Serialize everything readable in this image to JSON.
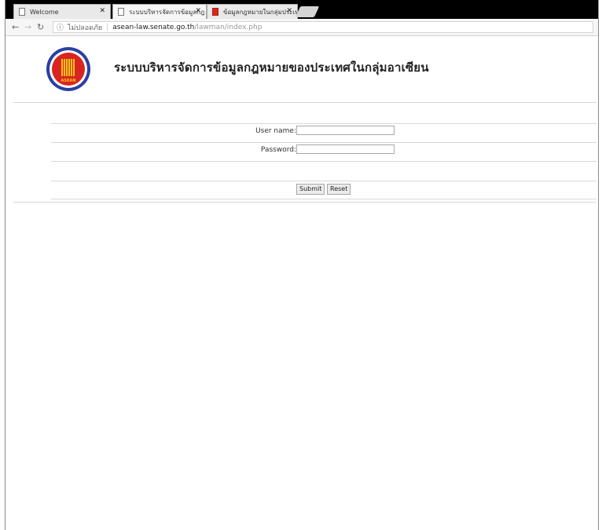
{
  "browser": {
    "tabs": [
      {
        "label": "Welcome"
      },
      {
        "label": "ระบบบริหารจัดการข้อมูลกฎ"
      },
      {
        "label": "ข้อมูลกฎหมายในกลุ่มประเทศ"
      }
    ],
    "omnibox": {
      "security_text": "ไม่ปลอดภัย",
      "host": "asean-law.senate.go.th",
      "path": "/lawman/index.php"
    }
  },
  "header": {
    "logo_text": "ASEAN",
    "title": "ระบบบริหารจัดการข้อมูลกฎหมายของประเทศในกลุ่มอาเซียน"
  },
  "login": {
    "username_label": "User name:",
    "username_value": "",
    "password_label": "Password:",
    "password_value": "",
    "submit_label": "Submit",
    "reset_label": "Reset"
  }
}
